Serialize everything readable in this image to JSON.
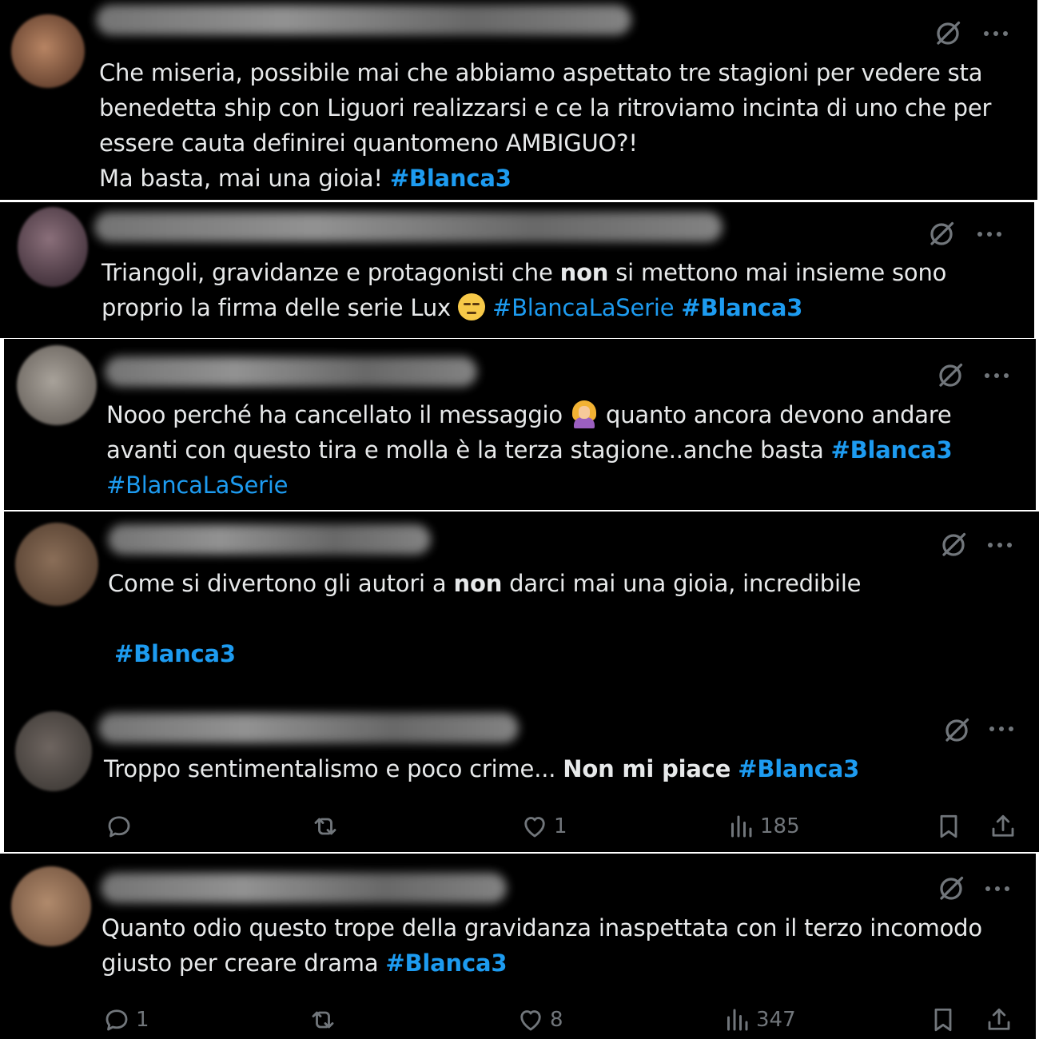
{
  "colors": {
    "background": "#000000",
    "text": "#e7e9ea",
    "hashtag": "#1d9bf0",
    "muted": "#71767b"
  },
  "icons": {
    "grok": "grok-icon",
    "more": "more-icon",
    "reply": "reply-icon",
    "retweet": "retweet-icon",
    "like": "like-icon",
    "views": "views-icon",
    "bookmark": "bookmark-icon",
    "share": "share-icon"
  },
  "tweets": [
    {
      "id": "t1",
      "text_parts": [
        "Che miseria, possibile mai che abbiamo aspettato tre stagioni per vedere sta benedetta ship con Liguori realizzarsi e ce la ritroviamo incinta di uno che per essere cauta definirei quantomeno AMBIGUO?!",
        "Ma basta, mai una gioia! "
      ],
      "hashtags": [
        "#Blanca3"
      ]
    },
    {
      "id": "t2",
      "text_before_bold": "Triangoli, gravidanze e protagonisti che ",
      "bold": "non",
      "text_after_bold": " si mettono mai insieme sono proprio la firma delle serie Lux ",
      "emoji": "unamused-face",
      "hashtags": [
        "#BlancaLaSerie",
        "#Blanca3"
      ]
    },
    {
      "id": "t3",
      "text_before_emoji": "Nooo perché ha cancellato il messaggio ",
      "emoji": "woman-facepalming",
      "text_after_emoji": " quanto ancora devono andare avanti con questo tira e molla è la terza stagione..anche basta ",
      "hashtags": [
        "#Blanca3",
        "#BlancaLaSerie"
      ]
    },
    {
      "id": "t4",
      "text_before_bold": "Come si divertono gli autori a ",
      "bold": "non",
      "text_after_bold": " darci mai una gioia, incredibile",
      "hashtags": [
        "#Blanca3"
      ]
    },
    {
      "id": "t5",
      "text_before_bold": "Troppo sentimentalismo e poco crime... ",
      "bold": "Non mi piace",
      "hashtags": [
        "#Blanca3"
      ],
      "actions": {
        "replies": "",
        "retweets": "",
        "likes": "1",
        "views": "185"
      }
    },
    {
      "id": "t6",
      "text": "Quanto odio questo trope della gravidanza inaspettata con il terzo incomodo giusto per creare drama ",
      "hashtags": [
        "#Blanca3"
      ],
      "actions": {
        "replies": "1",
        "retweets": "",
        "likes": "8",
        "views": "347"
      }
    }
  ]
}
